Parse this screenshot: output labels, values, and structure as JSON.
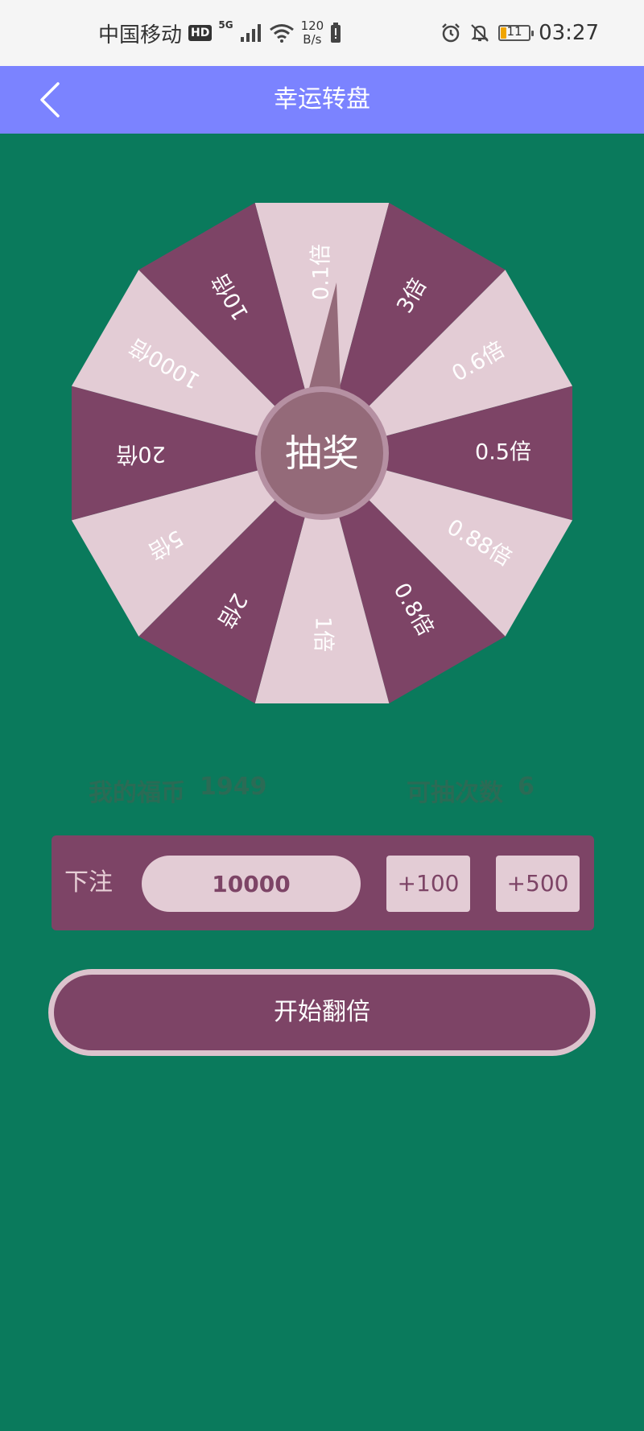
{
  "status_bar": {
    "carrier": "中国移动",
    "hd": "HD",
    "network": "5G",
    "speed_value": "120",
    "speed_unit": "B/s",
    "battery_level": "11",
    "time": "03:27",
    "icons": [
      "signal-icon",
      "wifi-icon",
      "battery-saver-icon",
      "alarm-icon",
      "mute-icon",
      "battery-icon"
    ]
  },
  "app_bar": {
    "title": "幸运转盘",
    "back_icon": "chevron-left-icon",
    "color": "#7b83ff"
  },
  "wheel": {
    "segments": [
      "0.1倍",
      "3倍",
      "0.6倍",
      "0.5倍",
      "0.88倍",
      "0.8倍",
      "1倍",
      "2倍",
      "5倍",
      "20倍",
      "1000倍",
      "10倍"
    ],
    "center_label": "抽奖",
    "colors": {
      "dark": "#7d4466",
      "light": "#e3ccd5",
      "center": "#946a79",
      "center_ring": "#b590a2"
    }
  },
  "stats": {
    "coins_label": "我的福币",
    "coins_value": "1949",
    "draws_label": "可抽次数",
    "draws_value": "6"
  },
  "bet": {
    "label": "下注",
    "value": "10000",
    "add_100": "+100",
    "add_500": "+500"
  },
  "start_button": "开始翻倍",
  "colors": {
    "background": "#0a7a5c",
    "panel": "#7d4466",
    "panel_light": "#e3ccd5"
  }
}
